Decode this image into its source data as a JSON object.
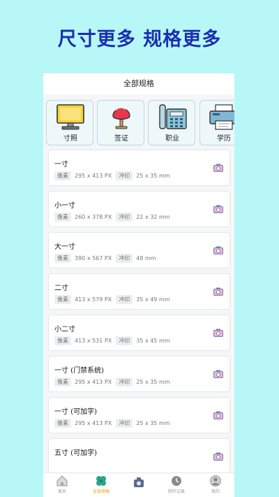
{
  "headline": "尺寸更多 规格更多",
  "topbar_title": "全部规格",
  "categories": [
    {
      "label": "寸照",
      "icon": "monitor-icon"
    },
    {
      "label": "签证",
      "icon": "chair-icon"
    },
    {
      "label": "职业",
      "icon": "telephone-icon"
    },
    {
      "label": "学历",
      "icon": "printer-icon"
    }
  ],
  "pixel_tag": "像素",
  "print_tag": "冲印",
  "specs": [
    {
      "name": "一寸",
      "pixels": "295 x 413 PX",
      "print": "25 x 35 mm"
    },
    {
      "name": "小一寸",
      "pixels": "260 x 378 PX",
      "print": "22 x 32 mm"
    },
    {
      "name": "大一寸",
      "pixels": "390 x 567 PX",
      "print": "48 mm"
    },
    {
      "name": "二寸",
      "pixels": "413 x 579 PX",
      "print": "35 x 49 mm"
    },
    {
      "name": "小二寸",
      "pixels": "413 x 531 PX",
      "print": "35 x 45 mm"
    },
    {
      "name": "一寸 (门禁系统)",
      "pixels": "295 x 413 PX",
      "print": "25 x 35 mm"
    },
    {
      "name": "一寸 (可加字)",
      "pixels": "295 x 413 PX",
      "print": "25 x 35 mm"
    },
    {
      "name": "五寸 (可加字)",
      "pixels": "",
      "print": ""
    }
  ],
  "tabs": [
    {
      "label": "首页",
      "icon": "home-icon"
    },
    {
      "label": "全部规格",
      "icon": "clover-icon",
      "active": true
    },
    {
      "label": "",
      "icon": "camera-icon"
    },
    {
      "label": "制作记录",
      "icon": "history-icon"
    },
    {
      "label": "我的",
      "icon": "profile-icon"
    }
  ],
  "colors": {
    "background": "#b8f7f7",
    "headline": "#1a2fb0",
    "active_tab": "#f0a000"
  }
}
